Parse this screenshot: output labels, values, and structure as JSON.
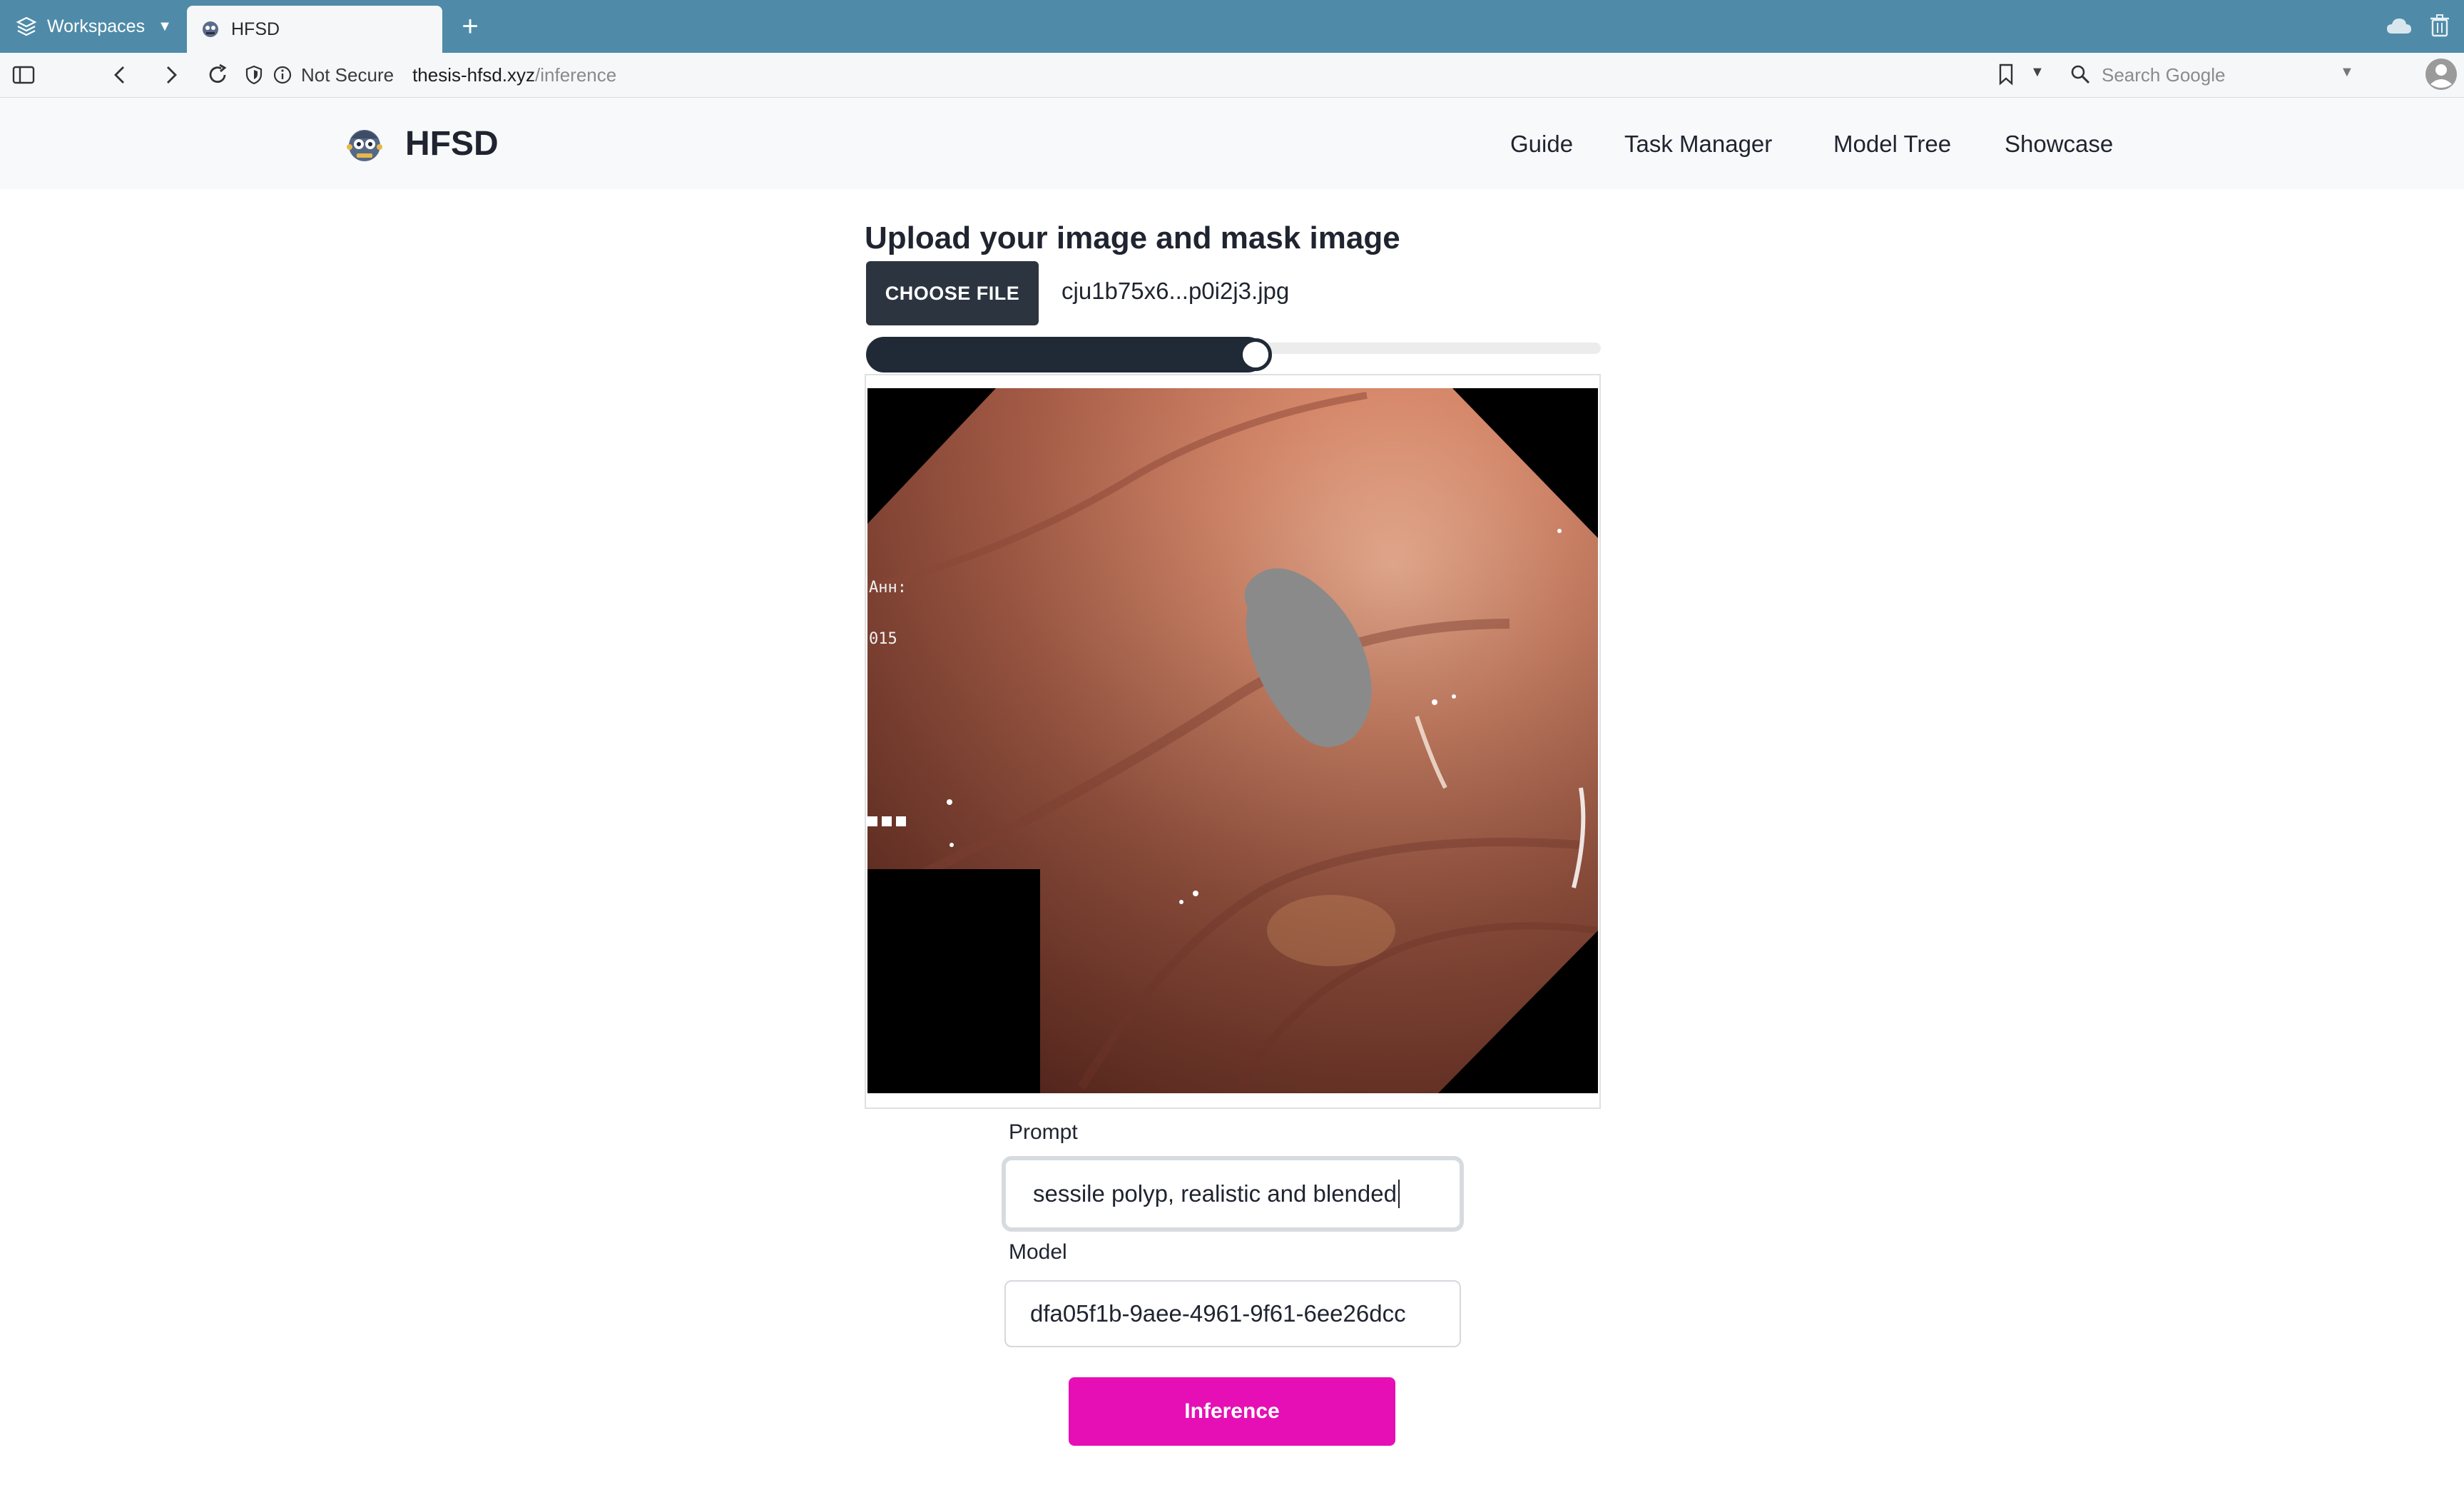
{
  "browser": {
    "workspaces_label": "Workspaces",
    "tab_title": "HFSD",
    "address": {
      "security": "Not Secure",
      "host": "thesis-hfsd.xyz",
      "path": "/inference"
    },
    "search_placeholder": "Search Google"
  },
  "site": {
    "brand": "HFSD",
    "nav": [
      "Guide",
      "Task Manager",
      "Model Tree",
      "Showcase"
    ]
  },
  "upload": {
    "title": "Upload your image and mask image",
    "choose_file_label": "CHOOSE FILE",
    "file_name": "cju1b75x6...p0i2j3.jpg",
    "slider_fraction": 0.53
  },
  "form": {
    "prompt_label": "Prompt",
    "prompt_value": "sessile polyp, realistic and blended",
    "model_label": "Model",
    "model_value": "dfa05f1b-9aee-4961-9f61-6ee26dcc",
    "inference_label": "Inference"
  },
  "colors": {
    "tabbar": "#4f8ba9",
    "header_bg": "#f8f9fa",
    "dark_button": "#2c3440",
    "accent_button": "#e60fb5"
  },
  "icons": [
    "workspaces-icon",
    "favicon-icon",
    "sidebar-toggle-icon",
    "back-icon",
    "forward-icon",
    "reload-icon",
    "shield-icon",
    "info-icon",
    "bookmark-icon",
    "search-icon",
    "profile-icon",
    "cloud-icon",
    "trash-icon",
    "logo-icon"
  ]
}
